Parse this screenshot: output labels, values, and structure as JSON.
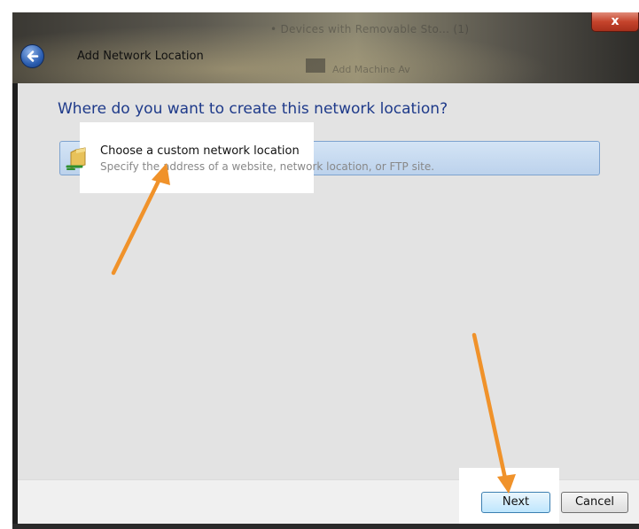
{
  "window": {
    "title": "Add Network Location",
    "background_text": "• Devices with Removable Sto... (1)",
    "background_text2": "Add Machine Av",
    "close_label": "x"
  },
  "page": {
    "heading": "Where do you want to create this network location?"
  },
  "option": {
    "title": "Choose a custom network location",
    "description": "Specify the address of a website, network location, or FTP site."
  },
  "buttons": {
    "next_label": "Next",
    "cancel_label": "Cancel"
  },
  "colors": {
    "heading": "#1e3a8a",
    "annotation_arrow": "#f0922a",
    "option_selected": "#c8dbf0"
  },
  "icons": {
    "back": "back-arrow-icon",
    "option": "folder-network-icon",
    "close": "close-icon"
  }
}
